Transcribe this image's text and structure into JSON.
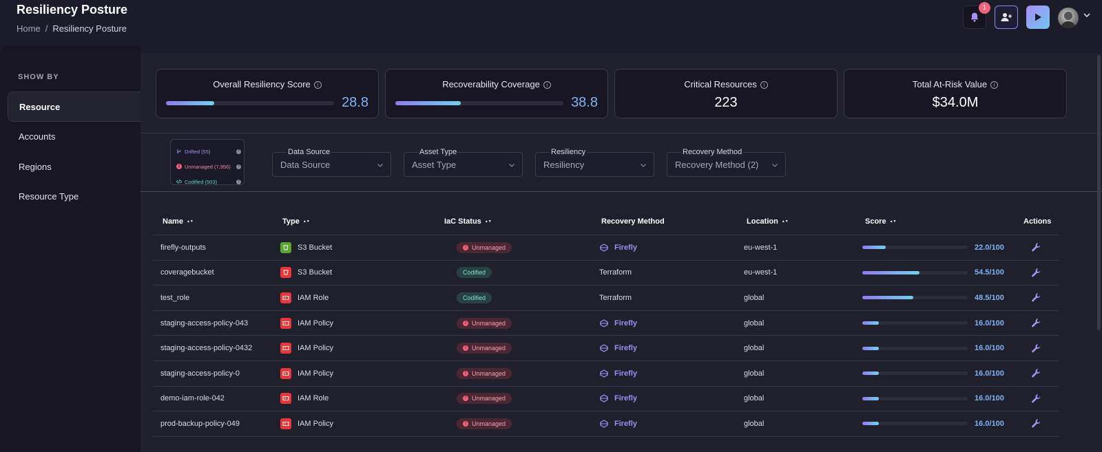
{
  "header": {
    "title": "Resiliency Posture",
    "breadcrumb": [
      "Home",
      "/",
      "Resiliency Posture"
    ],
    "notification_count": "1"
  },
  "sidebar": {
    "section_label": "SHOW BY",
    "items": [
      {
        "label": "Resource",
        "active": true
      },
      {
        "label": "Accounts",
        "active": false
      },
      {
        "label": "Regions",
        "active": false
      },
      {
        "label": "Resource Type",
        "active": false
      }
    ]
  },
  "stats": [
    {
      "label": "Overall Resiliency Score",
      "value": "28.8",
      "progress": 0.288
    },
    {
      "label": "Recoverability Coverage",
      "value": "38.8",
      "progress": 0.388
    },
    {
      "label": "Critical Resources",
      "value": "223"
    },
    {
      "label": "Total At-Risk Value",
      "value": "$34.0M"
    }
  ],
  "iac_legend": {
    "drifted": "Drifted (55)",
    "unmanaged": "Unmanaged (7,956)",
    "codified": "Codified (503)"
  },
  "filters": [
    {
      "label": "Data Source",
      "value": "Data Source"
    },
    {
      "label": "Asset Type",
      "value": "Asset Type"
    },
    {
      "label": "Resiliency",
      "value": "Resiliency"
    },
    {
      "label": "Recovery Method",
      "value": "Recovery Method (2)"
    }
  ],
  "table": {
    "columns": [
      "Name",
      "Type",
      "IaC Status",
      "Recovery Method",
      "Location",
      "Score",
      "Actions"
    ],
    "rows": [
      {
        "name": "firefly-outputs",
        "type": "S3 Bucket",
        "type_color": "green",
        "iac": "Unmanaged",
        "recovery": "Firefly",
        "location": "eu-west-1",
        "score": "22.0/100",
        "score_fraction": 0.22
      },
      {
        "name": "coveragebucket",
        "type": "S3 Bucket",
        "type_color": "red",
        "iac": "Codified",
        "recovery": "Terraform",
        "location": "eu-west-1",
        "score": "54.5/100",
        "score_fraction": 0.545
      },
      {
        "name": "test_role",
        "type": "IAM Role",
        "type_color": "red",
        "iac": "Codified",
        "recovery": "Terraform",
        "location": "global",
        "score": "48.5/100",
        "score_fraction": 0.485
      },
      {
        "name": "staging-access-policy-043",
        "type": "IAM Policy",
        "type_color": "red",
        "iac": "Unmanaged",
        "recovery": "Firefly",
        "location": "global",
        "score": "16.0/100",
        "score_fraction": 0.16
      },
      {
        "name": "staging-access-policy-0432",
        "type": "IAM Policy",
        "type_color": "red",
        "iac": "Unmanaged",
        "recovery": "Firefly",
        "location": "global",
        "score": "16.0/100",
        "score_fraction": 0.16
      },
      {
        "name": "staging-access-policy-0",
        "type": "IAM Policy",
        "type_color": "red",
        "iac": "Unmanaged",
        "recovery": "Firefly",
        "location": "global",
        "score": "16.0/100",
        "score_fraction": 0.16
      },
      {
        "name": "demo-iam-role-042",
        "type": "IAM Role",
        "type_color": "red",
        "iac": "Unmanaged",
        "recovery": "Firefly",
        "location": "global",
        "score": "16.0/100",
        "score_fraction": 0.16
      },
      {
        "name": "prod-backup-policy-049",
        "type": "IAM Policy",
        "type_color": "red",
        "iac": "Unmanaged",
        "recovery": "Firefly",
        "location": "global",
        "score": "16.0/100",
        "score_fraction": 0.16
      }
    ]
  },
  "colors": {
    "background": "#1c1b29",
    "accent_purple": "#9d8ef6",
    "score_blue": "#7fb3f5",
    "unmanaged_red": "#f2627b",
    "codified_teal": "#7ee0d0"
  }
}
